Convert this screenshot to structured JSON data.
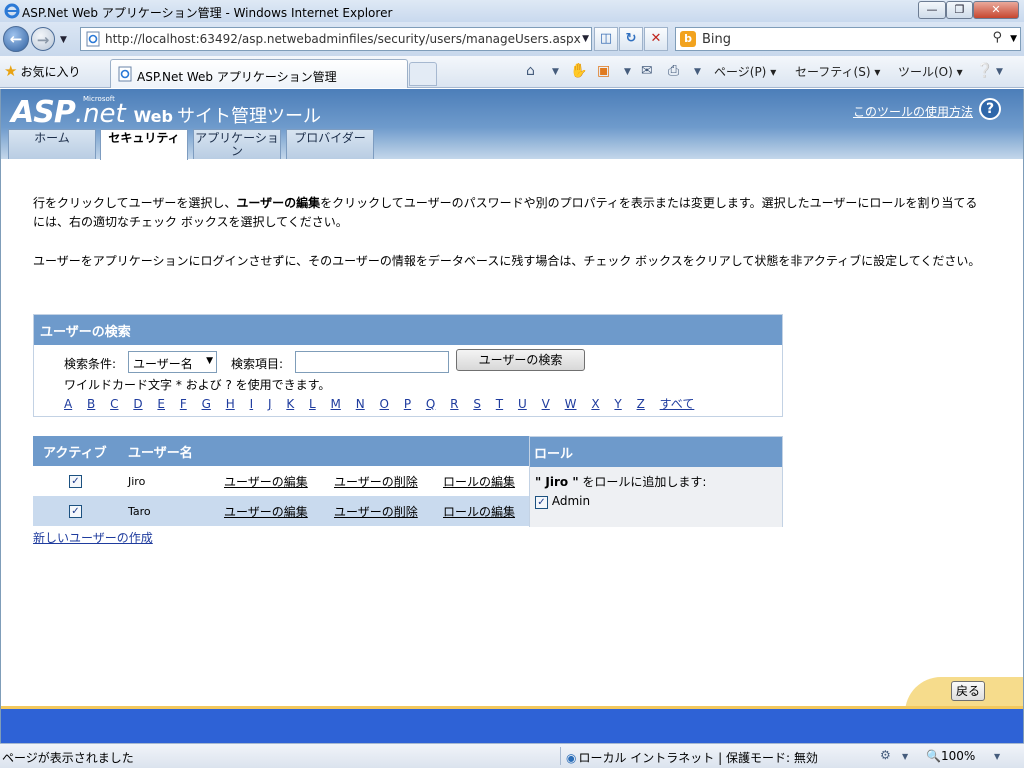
{
  "window": {
    "title": "ASP.Net Web アプリケーション管理 - Windows Internet Explorer",
    "min_glyph": "—",
    "max_glyph": "❐",
    "close_glyph": "✕"
  },
  "address": {
    "url": "http://localhost:63492/asp.netwebadminfiles/security/users/manageUsers.aspx",
    "search_text": "Bing"
  },
  "favbar": {
    "favorites_label": "お気に入り",
    "tab_title": "ASP.Net Web アプリケーション管理",
    "page_menu": "ページ(P)",
    "safety_menu": "セーフティ(S)",
    "tools_menu": "ツール(O)"
  },
  "header": {
    "logo_asp": "ASP",
    "logo_net": ".net",
    "logo_ms": "Microsoft",
    "logo_web": "Web",
    "logo_tool": "サイト管理ツール",
    "help_link": "このツールの使用方法",
    "help_icon": "?"
  },
  "tabs": [
    {
      "label": "ホーム",
      "active": false
    },
    {
      "label": "セキュリティ",
      "active": true
    },
    {
      "label": "アプリケーション",
      "active": false
    },
    {
      "label": "プロバイダー",
      "active": false
    }
  ],
  "description": {
    "line1_pre": "行をクリックしてユーザーを選択し、",
    "line1_bold": "ユーザーの編集",
    "line1_post": "をクリックしてユーザーのパスワードや別のプロパティを表示または変更します。選択したユーザーにロールを割り当てるには、右の適切なチェック ボックスを選択してください。",
    "line2": "ユーザーをアプリケーションにログインさせずに、そのユーザーの情報をデータベースに残す場合は、チェック ボックスをクリアして状態を非アクティブに設定してください。"
  },
  "search": {
    "header": "ユーザーの検索",
    "condition_label": "検索条件:",
    "condition_value": "ユーザー名",
    "item_label": "検索項目:",
    "item_value": "",
    "button": "ユーザーの検索",
    "wildcard_note": "ワイルドカード文字 * および ? を使用できます。",
    "letters": [
      "A",
      "B",
      "C",
      "D",
      "E",
      "F",
      "G",
      "H",
      "I",
      "J",
      "K",
      "L",
      "M",
      "N",
      "O",
      "P",
      "Q",
      "R",
      "S",
      "T",
      "U",
      "V",
      "W",
      "X",
      "Y",
      "Z"
    ],
    "all_label": "すべて"
  },
  "users": {
    "col_active": "アクティブ",
    "col_username": "ユーザー名",
    "rows": [
      {
        "active": true,
        "name": "Jiro",
        "edit": "ユーザーの編集",
        "delete": "ユーザーの削除",
        "roles": "ロールの編集"
      },
      {
        "active": true,
        "name": "Taro",
        "edit": "ユーザーの編集",
        "delete": "ユーザーの削除",
        "roles": "ロールの編集"
      }
    ],
    "create_link": "新しいユーザーの作成"
  },
  "roles_panel": {
    "header": "ロール",
    "prompt_user": "\" Jiro \"",
    "prompt_text": " をロールに追加します:",
    "roles": [
      {
        "name": "Admin",
        "checked": true
      }
    ]
  },
  "footer": {
    "back_button": "戻る"
  },
  "status": {
    "text": "ページが表示されました",
    "zone": "ローカル イントラネット | 保護モード: 無効",
    "zoom": "100%"
  },
  "colors": {
    "panel_header": "#6e9acb",
    "footer_bar": "#2e62d6",
    "footer_accent": "#f3c85c",
    "link": "#1f3c9e"
  }
}
